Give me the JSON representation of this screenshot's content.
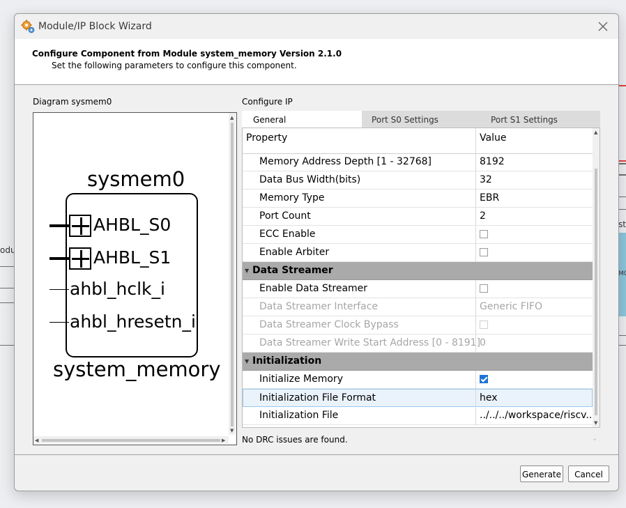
{
  "window": {
    "title": "Module/IP Block Wizard",
    "close_icon": "close-icon"
  },
  "header": {
    "title": "Configure Component from Module system_memory Version 2.1.0",
    "subtitle": "Set the following parameters to configure this component."
  },
  "background_app": {
    "left_fragment": "odu",
    "right_fragment": "st",
    "right_fragment2": "M0"
  },
  "diagram": {
    "label": "Diagram sysmem0",
    "instance_name": "sysmem0",
    "module_name": "system_memory",
    "pins": [
      {
        "label": "AHBL_S0",
        "type": "bus"
      },
      {
        "label": "AHBL_S1",
        "type": "bus"
      },
      {
        "label": "ahbl_hclk_i",
        "type": "signal"
      },
      {
        "label": "ahbl_hresetn_i",
        "type": "signal"
      }
    ]
  },
  "configure": {
    "label": "Configure IP",
    "tabs": [
      {
        "label": "General",
        "active": true
      },
      {
        "label": "Port S0 Settings",
        "active": false
      },
      {
        "label": "Port S1 Settings",
        "active": false
      }
    ],
    "columns": {
      "property": "Property",
      "value": "Value"
    },
    "rows": [
      {
        "name": "Memory Address Depth  [1 - 32768]",
        "value": "8192"
      },
      {
        "name": "Data Bus Width(bits)",
        "value": "32"
      },
      {
        "name": "Memory Type",
        "value": "EBR"
      },
      {
        "name": "Port Count",
        "value": "2"
      },
      {
        "name": "ECC Enable",
        "checked": false
      },
      {
        "name": "Enable Arbiter",
        "checked": false
      },
      {
        "group": "Data Streamer"
      },
      {
        "name": "Enable Data Streamer",
        "checked": false
      },
      {
        "name": "Data Streamer Interface",
        "value": "Generic FIFO",
        "disabled": true
      },
      {
        "name": "Data Streamer Clock Bypass",
        "checked": false,
        "disabled": true
      },
      {
        "name": "Data Streamer Write Start Address  [0 - 8191]",
        "value": "0",
        "disabled": true
      },
      {
        "group": "Initialization"
      },
      {
        "name": "Initialize Memory",
        "checked": true
      },
      {
        "name": "Initialization File Format",
        "value": "hex",
        "selected": true
      },
      {
        "name": "Initialization File",
        "value": "../../../workspace/riscv..."
      }
    ]
  },
  "status": {
    "drc": "No DRC issues are found."
  },
  "buttons": {
    "generate": "Generate",
    "cancel": "Cancel"
  },
  "colors": {
    "group_row": "#aaaaaa",
    "checkbox_on": "#1e73d6",
    "selected_row": "#eaf3fb"
  }
}
